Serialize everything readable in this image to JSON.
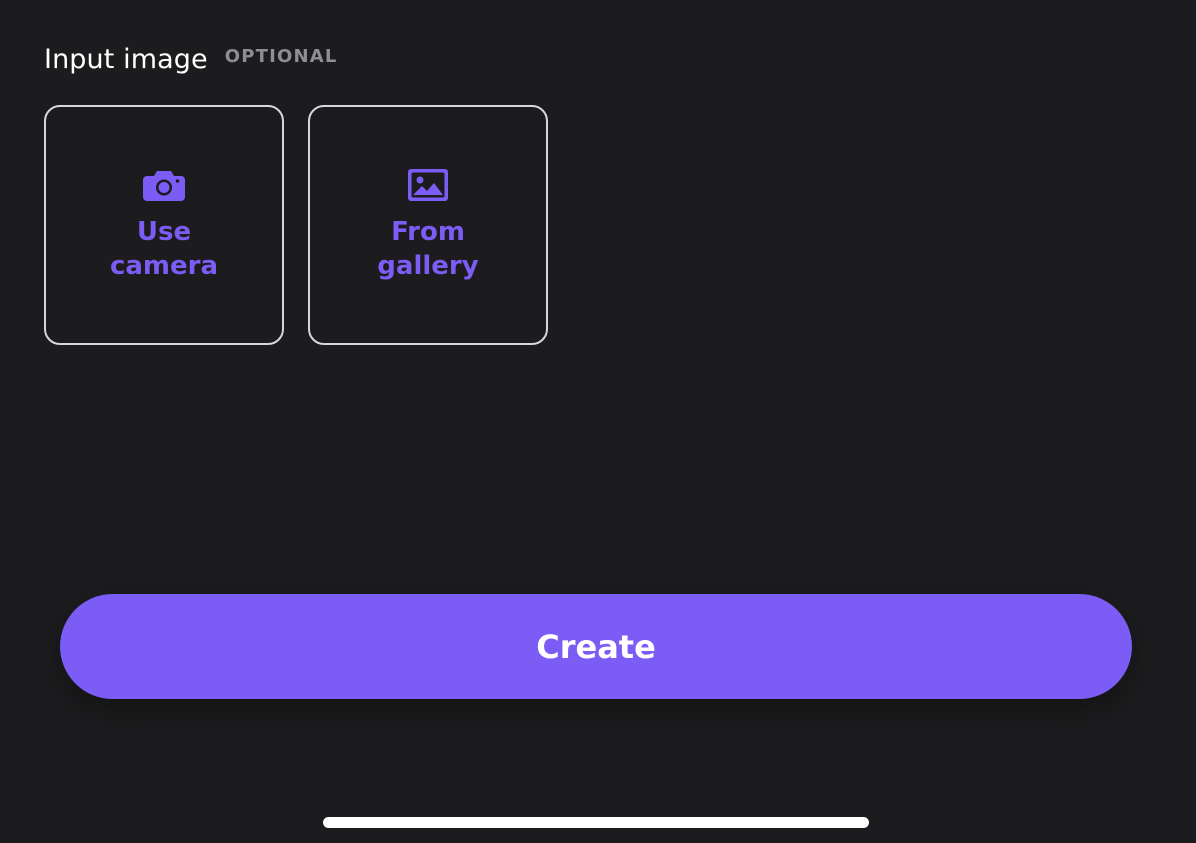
{
  "section": {
    "title": "Input image",
    "optional_tag": "OPTIONAL"
  },
  "options": [
    {
      "label": "Use camera",
      "icon": "camera-icon"
    },
    {
      "label": "From gallery",
      "icon": "image-icon"
    }
  ],
  "actions": {
    "create_label": "Create"
  },
  "colors": {
    "accent": "#7b5cf5",
    "background": "#1c1c1e",
    "muted": "#8e8e93",
    "border": "#d8d8dc"
  }
}
